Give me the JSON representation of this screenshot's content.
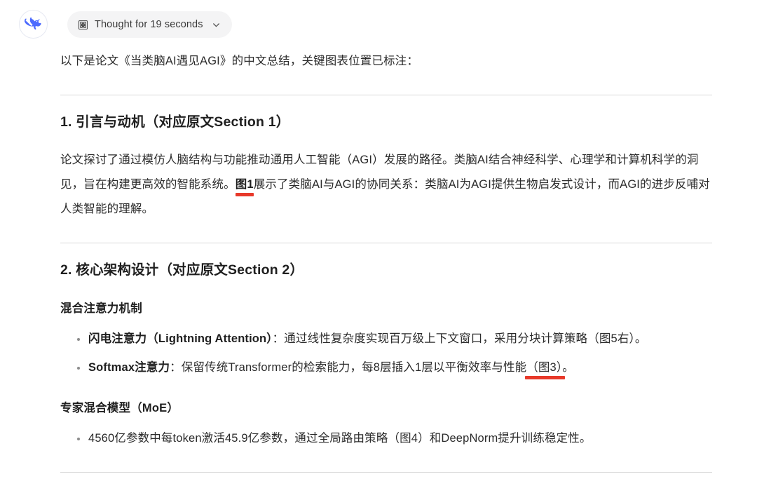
{
  "accent": {
    "highlight_red": "#e8392a",
    "avatar_blue": "#4d6bfe",
    "chip_bg": "#f4f4f5",
    "divider": "#d9d9d9"
  },
  "assistant": {
    "avatar_icon": "deepseek-whale-logo"
  },
  "thought": {
    "icon": "atom-icon",
    "label": "Thought for 19 seconds",
    "chevron_icon": "chevron-down-icon"
  },
  "content": {
    "intro": "以下是论文《当类脑AI遇见AGI》的中文总结，关键图表位置已标注：",
    "sections": [
      {
        "heading": "1. 引言与动机（对应原文Section 1）",
        "paragraph": {
          "before": "论文探讨了通过模仿人脑结构与功能推动通用人工智能（AGI）发展的路径。类脑AI结合神经科学、心理学和计算机科学的洞见，旨在构建更高效的智能系统。",
          "highlight": "图1",
          "after": "展示了类脑AI与AGI的协同关系：类脑AI为AGI提供生物启发式设计，而AGI的进步反哺对人类智能的理解。"
        }
      },
      {
        "heading": "2. 核心架构设计（对应原文Section 2）",
        "subsections": [
          {
            "title": "混合注意力机制",
            "bullets": [
              {
                "bold": "闪电注意力（Lightning Attention）",
                "text": "：通过线性复杂度实现百万级上下文窗口，采用分块计算策略（图5右）。",
                "highlight": null
              },
              {
                "bold": "Softmax注意力",
                "text": "：保留传统Transformer的检索能力，每8层插入1层以平衡效率与性能",
                "highlight": "（图3）",
                "tail": "。"
              }
            ]
          },
          {
            "title": "专家混合模型（MoE）",
            "bullets": [
              {
                "bold": "",
                "text": "4560亿参数中每token激活45.9亿参数，通过全局路由策略（图4）和DeepNorm提升训练稳定性。",
                "highlight": null
              }
            ]
          }
        ]
      }
    ]
  }
}
